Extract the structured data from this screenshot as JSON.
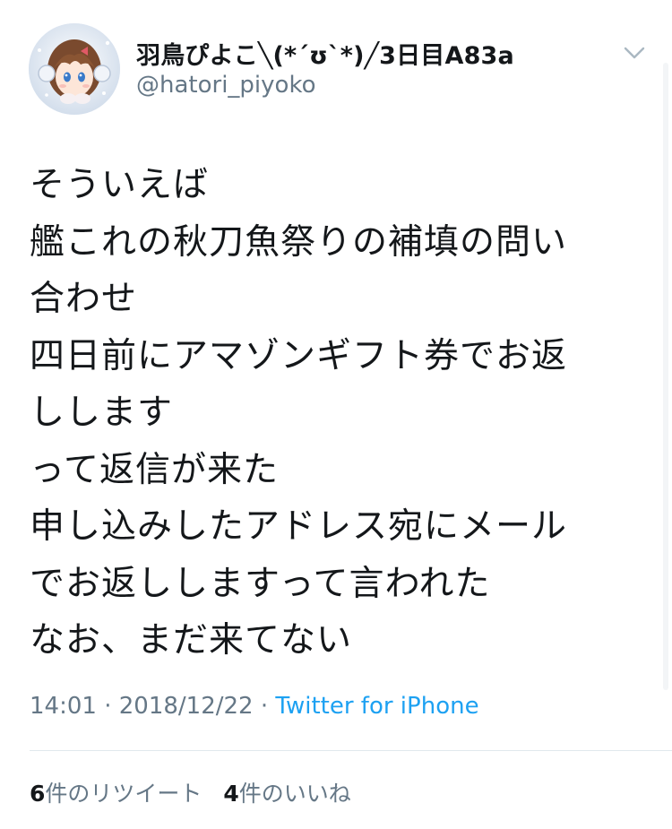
{
  "author": {
    "display_name": "羽鳥ぴよこ╲(*´ʊ`*)╱3日目A83a",
    "handle": "@hatori_piyoko",
    "avatar_icon": "avatar-anime-girl-headphones"
  },
  "tweet": {
    "lines": [
      "そういえば",
      "艦これの秋刀魚祭りの補填の問い",
      "合わせ",
      "四日前にアマゾンギフト券でお返",
      "しします",
      "って返信が来た",
      "申し込みしたアドレス宛にメール",
      "でお返ししますって言われた",
      "なお、まだ来てない"
    ],
    "time": "14:01",
    "date": "2018/12/22",
    "separator": "·",
    "source": "Twitter for iPhone"
  },
  "stats": {
    "retweet_count": "6",
    "retweet_label": "件のリツイート",
    "like_count": "4",
    "like_label": "件のいいね"
  },
  "colors": {
    "text": "#14171a",
    "secondary": "#657786",
    "link": "#1da1f2",
    "divider": "#e1e8ed"
  }
}
